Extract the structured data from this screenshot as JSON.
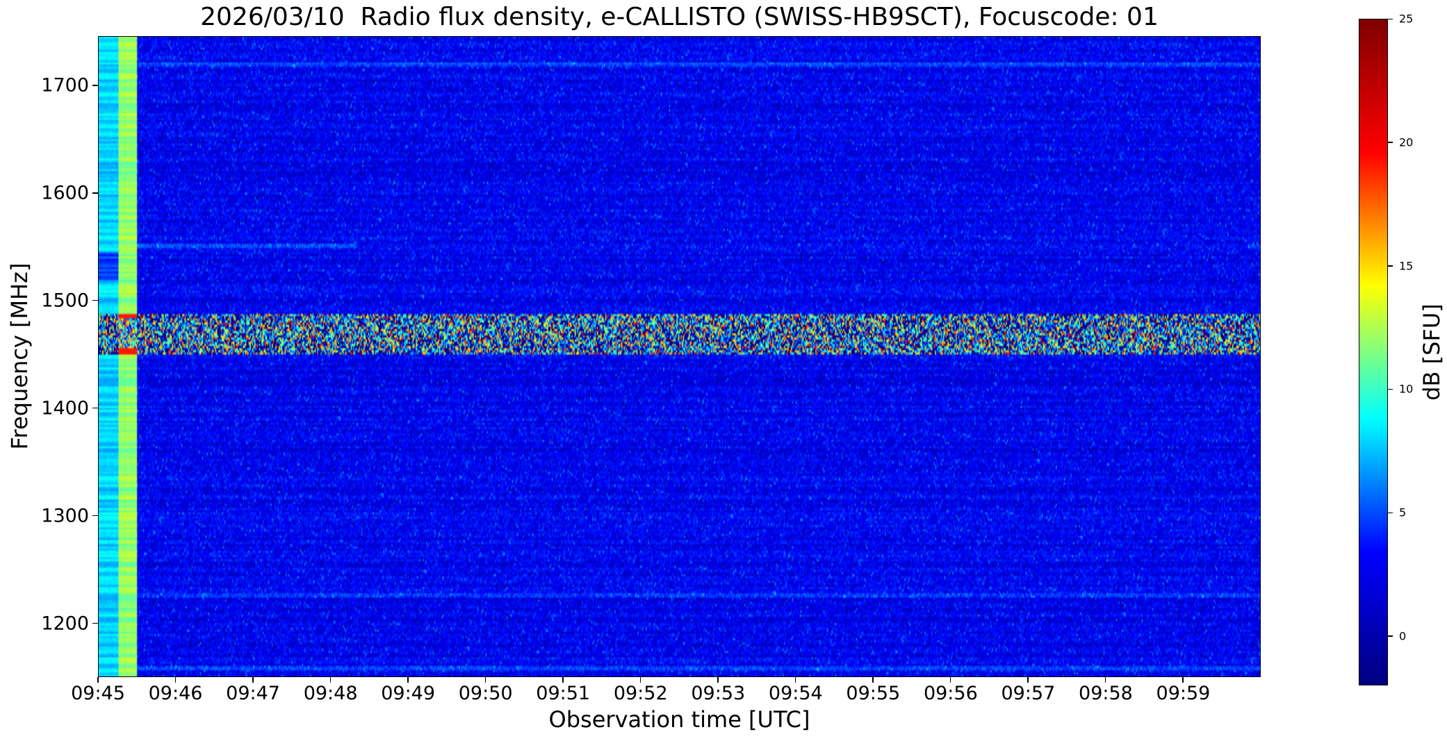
{
  "chart_data": {
    "type": "heatmap",
    "title": "2026/03/10  Radio flux density, e-CALLISTO (SWISS-HB9SCT), Focuscode: 01",
    "xlabel": "Observation time [UTC]",
    "ylabel": "Frequency [MHz]",
    "x_range": [
      "09:45:00",
      "10:00:00"
    ],
    "y_range_mhz": [
      1150,
      1746
    ],
    "x_ticks": [
      "09:45",
      "09:46",
      "09:47",
      "09:48",
      "09:49",
      "09:50",
      "09:51",
      "09:52",
      "09:53",
      "09:54",
      "09:55",
      "09:56",
      "09:57",
      "09:58",
      "09:59"
    ],
    "y_ticks": [
      1200,
      1300,
      1400,
      1500,
      1600,
      1700
    ],
    "colormap": "jet",
    "colorbar": {
      "label": "dB [SFU]",
      "range": [
        -2,
        25
      ],
      "ticks": [
        0,
        5,
        10,
        15,
        20,
        25
      ],
      "colors": [
        "#00007f",
        "#0000ff",
        "#00ffff",
        "#ffff00",
        "#ff0000",
        "#7f0000"
      ]
    },
    "features": {
      "background_level_db": 1,
      "interference_band_mhz": [
        1450,
        1488
      ],
      "interference_band_level_db": [
        0,
        24
      ],
      "calibration_columns": [
        {
          "time": [
            "09:45:00",
            "09:45:15"
          ],
          "level_db": 7
        },
        {
          "time": [
            "09:45:15",
            "09:45:30"
          ],
          "level_db": 12
        }
      ],
      "narrow_lines_mhz": [
        1551,
        1226,
        1720,
        1158
      ]
    }
  }
}
